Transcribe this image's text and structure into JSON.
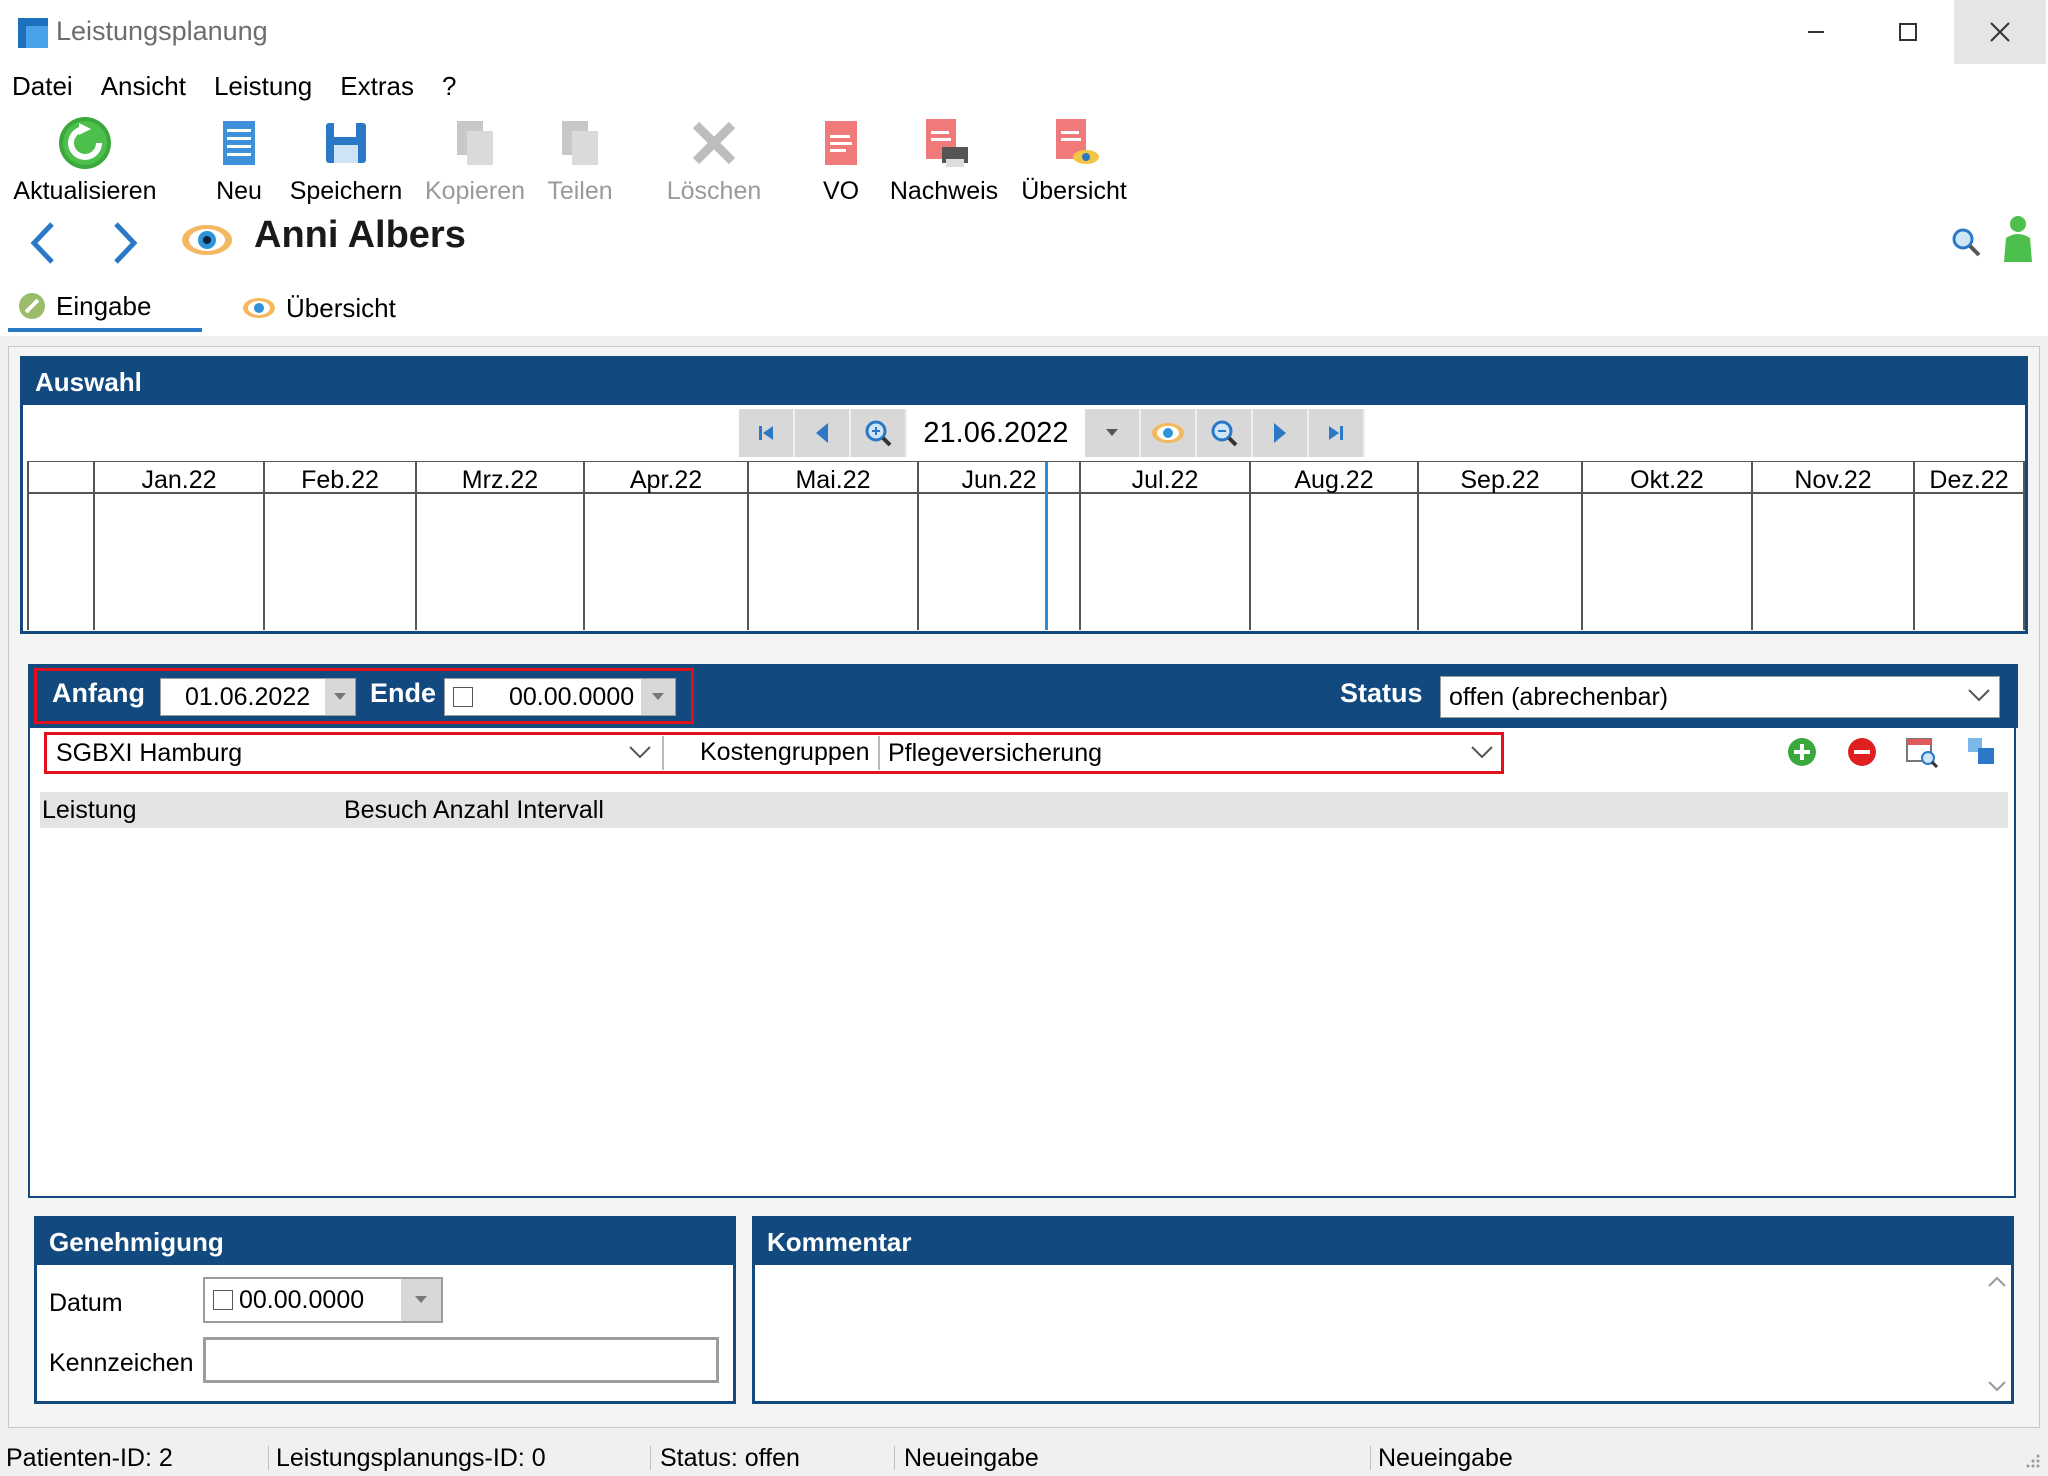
{
  "window": {
    "title": "Leistungsplanung"
  },
  "menu": [
    "Datei",
    "Ansicht",
    "Leistung",
    "Extras",
    "?"
  ],
  "toolbar": {
    "aktualisieren": "Aktualisieren",
    "neu": "Neu",
    "speichern": "Speichern",
    "kopieren": "Kopieren",
    "teilen": "Teilen",
    "loeschen": "Löschen",
    "vo": "VO",
    "nachweis": "Nachweis",
    "uebersicht": "Übersicht"
  },
  "patient": {
    "name": "Anni Albers"
  },
  "tabs": {
    "eingabe": "Eingabe",
    "uebersicht": "Übersicht"
  },
  "auswahl": {
    "title": "Auswahl",
    "date": "21.06.2022",
    "months": [
      "Jan.22",
      "Feb.22",
      "Mrz.22",
      "Apr.22",
      "Mai.22",
      "Jun.22",
      "Jul.22",
      "Aug.22",
      "Sep.22",
      "Okt.22",
      "Nov.22",
      "Dez.22"
    ]
  },
  "leistung": {
    "anfang_label": "Anfang",
    "anfang_value": "01.06.2022",
    "ende_label": "Ende",
    "ende_value": "00.00.0000",
    "status_label": "Status",
    "status_value": "offen (abrechenbar)",
    "katalog_value": "SGBXI Hamburg",
    "kostengruppen_label": "Kostengruppen",
    "kostengruppen_value": "Pflegeversicherung",
    "col_leistung": "Leistung",
    "col_besuch": "Besuch Anzahl Intervall"
  },
  "genehmigung": {
    "title": "Genehmigung",
    "datum_label": "Datum",
    "datum_value": "00.00.0000",
    "kennzeichen_label": "Kennzeichen",
    "kennzeichen_value": ""
  },
  "kommentar": {
    "title": "Kommentar",
    "value": ""
  },
  "statusbar": {
    "patienten_id": "Patienten-ID: 2",
    "leistungsplanungs_id": "Leistungsplanungs-ID: 0",
    "status": "Status: offen",
    "mode1": "Neueingabe",
    "mode2": "Neueingabe"
  },
  "colors": {
    "panel_header": "#124a80",
    "highlight": "#e0101c",
    "accent": "#2b78c6"
  }
}
